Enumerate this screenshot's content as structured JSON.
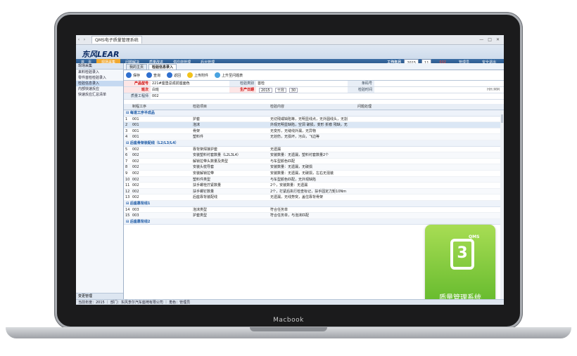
{
  "device": {
    "brand": "Macbook"
  },
  "browser": {
    "tab_title": "QMS电子质量管理系统",
    "back": "‹",
    "forward": "›"
  },
  "app": {
    "logo_text": "东风LEAR",
    "menu": [
      "首　页",
      "现场采集",
      "问题解决",
      "质量改进",
      "供应商管理",
      "后台管理"
    ],
    "active_menu": 1,
    "work_year_label": "工作年月",
    "work_year": "2015",
    "work_month": "11",
    "user_code": "002",
    "user_name": "管理员",
    "logout": "安全退出"
  },
  "sidebar": {
    "header": "现场采集",
    "items": [
      "来料检验录入",
      "零件首检检验录入",
      "检验信息录入",
      "内部快速反应",
      "快速反应汇总清单"
    ],
    "selected": 2,
    "footer": "变更管理"
  },
  "tabs": {
    "home": "我的主页",
    "current": "检验信息录入"
  },
  "toolbar": {
    "save": "保存",
    "query": "查询",
    "back": "返回",
    "upload": "上传附件",
    "escalate": "上升至问题表"
  },
  "form": {
    "product_label": "产品型号",
    "product_value": "221#座垫总成前座面色",
    "check_type_label": "检验类别",
    "check_type_value": "首检",
    "barcode_label": "条码号",
    "shift_label": "班次",
    "shift_value": "白班",
    "date_label": "生产日期",
    "date_year": "2015",
    "date_month": "十月",
    "date_day": "30",
    "check_time_label": "检验时间",
    "check_time_value": "HH:MM",
    "station_label": "质量工程师",
    "station_value": "002"
  },
  "grid": {
    "headers": [
      "",
      "制程工序",
      "检验项目",
      "检验内容",
      "问题处理"
    ],
    "groups": [
      {
        "title": "⊟ 每道工序半成品",
        "rows": [
          [
            "1",
            "001",
            "护套",
            "无切残或缺陷等，无明显线点，无外圆线头，无割"
          ],
          [
            "2",
            "001",
            "泡沫",
            "外观无明显缺陷，空洞 破损，变形 折痕 残缺，无"
          ],
          [
            "3",
            "001",
            "骨架",
            "无变形，无缝线外漏，无异物"
          ],
          [
            "4",
            "001",
            "塑料件",
            "无划伤，无损坏，污白，飞边等"
          ]
        ]
      },
      {
        "title": "⊟ 后座骨架装配线（L2/L3/L4）",
        "rows": [
          [
            "5",
            "002",
            "靠背架焊接护套",
            "无遗漏"
          ],
          [
            "6",
            "002",
            "安装塑料衬套数量（L2L3L4）",
            "安装数量：无遗漏，塑料衬套数量2个"
          ],
          [
            "7",
            "002",
            "解锁拉带头数量及类型",
            "与车型颜色匹配"
          ],
          [
            "8",
            "002",
            "安装头枕导套",
            "安装数量：无遗漏，无破损"
          ],
          [
            "9",
            "002",
            "安装解锁拉带",
            "安装数量：无遗漏，无破损，左右无混装"
          ],
          [
            "10",
            "002",
            "塑料件类型",
            "与车型颜色匹配，无外观缺陷"
          ],
          [
            "11",
            "002",
            "扶手螺栓拧紧数量",
            "2个，安装数量：无遗漏"
          ],
          [
            "12",
            "002",
            "扶手螺钉数量",
            "2个，打紧后执行检查标记，扶手固定力矩10Nm"
          ],
          [
            "13",
            "002",
            "后座靠背装配线",
            "无遗漏，无线势突，盖住靠背骨架"
          ]
        ]
      },
      {
        "title": "⊟ 后座靠背线1",
        "rows": [
          [
            "14",
            "003",
            "泡沫类型",
            "符合任务单"
          ],
          [
            "15",
            "003",
            "护套类型",
            "符合任务单，与泡沫匹配"
          ]
        ]
      },
      {
        "title": "⊟ 后座靠背线2",
        "rows": []
      }
    ]
  },
  "badge": {
    "letters": "QMS",
    "mono": "3",
    "caption": "质量管理系统"
  },
  "status": {
    "text": "当前年度：2015 ｜ 部门：东风李尔汽车座椅有限公司 ｜ 角色：管理员"
  }
}
